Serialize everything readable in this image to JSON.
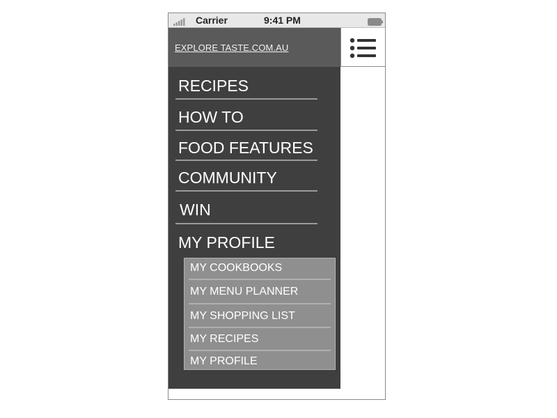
{
  "status_bar": {
    "carrier": "Carrier",
    "time": "9:41 PM"
  },
  "header": {
    "explore_link": "EXPLORE TASTE.COM.AU"
  },
  "nav": {
    "items": [
      {
        "label": "RECIPES"
      },
      {
        "label": "HOW TO"
      },
      {
        "label": "FOOD FEATURES"
      },
      {
        "label": "COMMUNITY"
      },
      {
        "label": "WIN"
      },
      {
        "label": "MY PROFILE"
      }
    ],
    "submenu": [
      {
        "label": "MY COOKBOOKS"
      },
      {
        "label": "MY MENU PLANNER"
      },
      {
        "label": "MY SHOPPING LIST"
      },
      {
        "label": "MY RECIPES"
      },
      {
        "label": "MY PROFILE"
      }
    ]
  },
  "colors": {
    "header_bg": "#5a5a5a",
    "drawer_bg": "#3f3f3f",
    "submenu_bg": "#8f8f8f",
    "status_bar_bg": "#e8e8e8"
  },
  "icons": {
    "signal": "signal-strength-icon",
    "battery": "battery-icon",
    "menu": "hamburger-menu-icon"
  }
}
